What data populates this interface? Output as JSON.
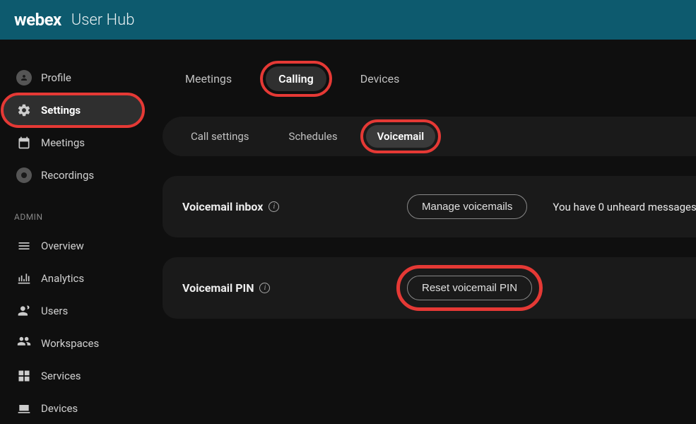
{
  "header": {
    "logo": "webex",
    "title": "User Hub"
  },
  "sidebar": {
    "top_items": [
      {
        "label": "Profile"
      },
      {
        "label": "Settings",
        "active": true
      },
      {
        "label": "Meetings"
      },
      {
        "label": "Recordings"
      }
    ],
    "admin_label": "ADMIN",
    "admin_items": [
      {
        "label": "Overview"
      },
      {
        "label": "Analytics"
      },
      {
        "label": "Users"
      },
      {
        "label": "Workspaces"
      },
      {
        "label": "Services"
      },
      {
        "label": "Devices"
      }
    ]
  },
  "tabs": {
    "items": [
      {
        "label": "Meetings"
      },
      {
        "label": "Calling",
        "active": true
      },
      {
        "label": "Devices"
      }
    ]
  },
  "subtabs": {
    "items": [
      {
        "label": "Call settings"
      },
      {
        "label": "Schedules"
      },
      {
        "label": "Voicemail",
        "active": true
      }
    ]
  },
  "voicemail_inbox": {
    "title": "Voicemail inbox",
    "button": "Manage voicemails",
    "status": "You have 0 unheard messages"
  },
  "voicemail_pin": {
    "title": "Voicemail PIN",
    "button": "Reset voicemail PIN"
  }
}
